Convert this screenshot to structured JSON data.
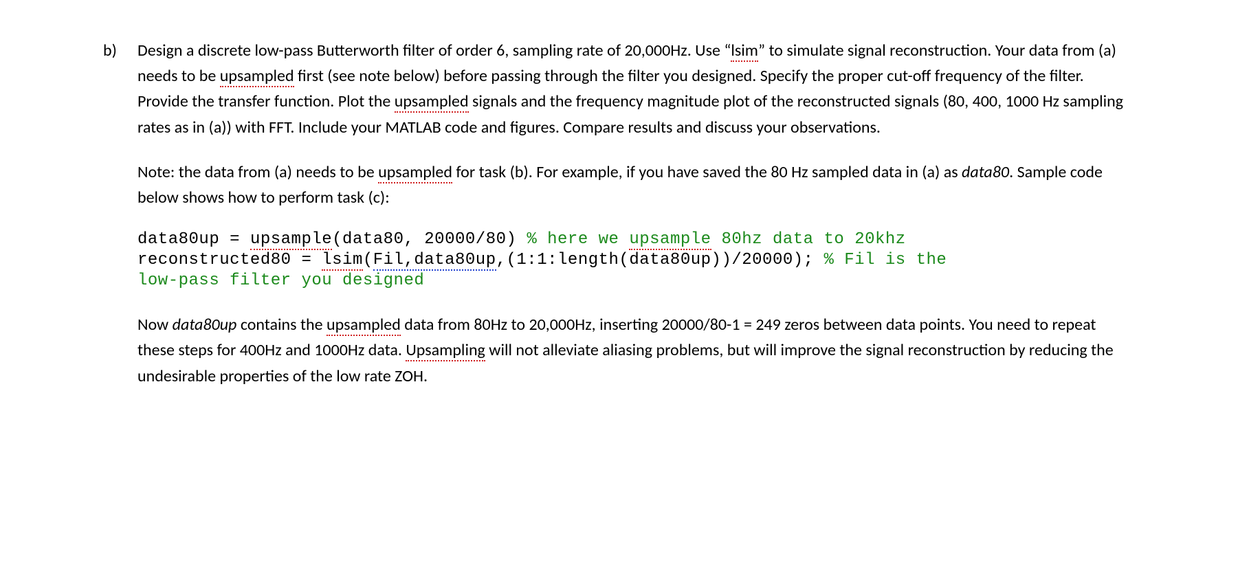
{
  "item_marker": "b)",
  "para1": {
    "t0": "Design a discrete low-pass Butterworth filter of order 6, sampling rate of 20,000Hz. Use “",
    "lsim": "lsim",
    "t1": "” to simulate signal reconstruction. Your data from (a) needs to be ",
    "upsampled1": "upsampled",
    "t2": " first (see note below) before passing through the filter you designed. Specify the proper cut-off frequency of the filter. Provide the transfer function. Plot the ",
    "upsampled2": "upsampled",
    "t3": " signals and the frequency magnitude plot of the reconstructed signals (80, 400, 1000 Hz sampling rates as in (a)) with FFT. Include your MATLAB code and figures. Compare results and discuss your observations."
  },
  "para2": {
    "t0": "Note: the data from (a) needs to be ",
    "upsampled": "upsampled",
    "t1": " for task (b). For example, if you have saved the 80 Hz sampled data in (a) as ",
    "data80": "data80",
    "t2": ". Sample code below shows how to perform task (c):"
  },
  "code": {
    "l1a": "data80up = ",
    "l1b": "upsample",
    "l1c": "(data80, 20000/80) ",
    "l1d": "% here we ",
    "l1e": "upsample",
    "l1f": " 80hz data to 20khz",
    "l2a": "reconstructed80 = ",
    "l2b": "lsim",
    "l2c": "(",
    "l2d": "Fil,data80up",
    "l2e": ",(1:1:length(data80up))/20000); ",
    "l2f": "% ",
    "l2g": "Fil",
    "l2h": " is the",
    "l3": "low-pass filter you designed"
  },
  "para3": {
    "t0": "Now ",
    "data80up": "data80up",
    "t1": " contains the ",
    "upsampled": "upsampled",
    "t2": " data from 80Hz to 20,000Hz, inserting 20000/80-1 = 249 zeros between data points. You need to repeat these steps for 400Hz and 1000Hz data. ",
    "upsampling": "Upsampling",
    "t3": " will not alleviate aliasing problems, but will improve the signal reconstruction by reducing the undesirable properties of the low rate ZOH."
  }
}
